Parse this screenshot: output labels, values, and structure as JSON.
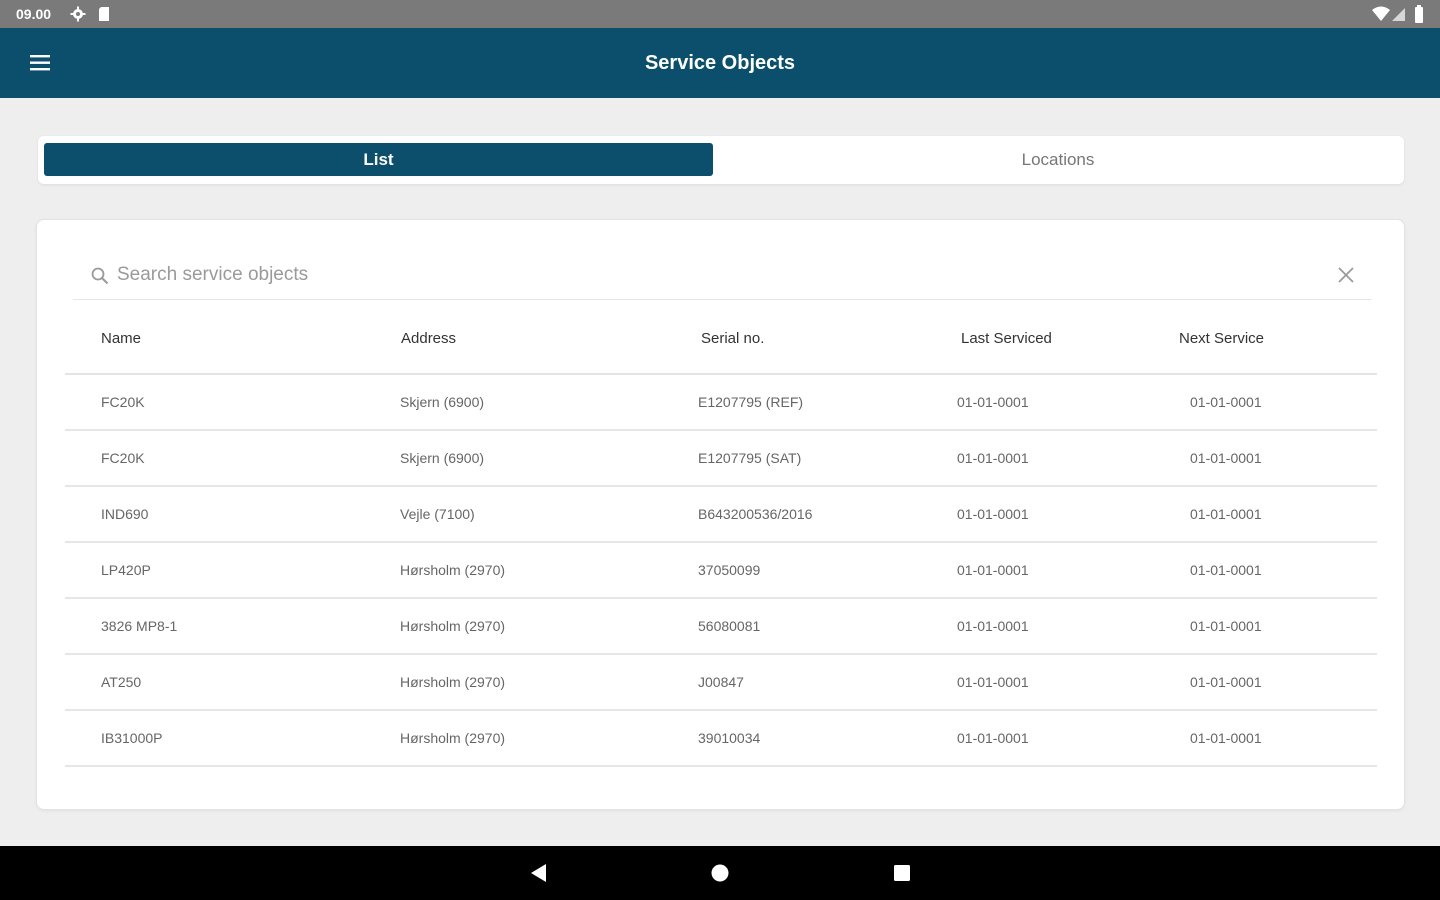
{
  "status_bar": {
    "time": "09.00",
    "icons": [
      "gear-icon",
      "sd-card-icon",
      "wifi-icon",
      "signal-icon",
      "battery-icon"
    ]
  },
  "app_bar": {
    "title": "Service Objects",
    "menu_icon": "hamburger-menu-icon",
    "background": "#0b4f6c"
  },
  "tabs": [
    {
      "label": "List",
      "active": true
    },
    {
      "label": "Locations",
      "active": false
    }
  ],
  "search": {
    "placeholder": "Search service objects",
    "value": "",
    "icon": "search-icon",
    "clear_icon": "close-icon"
  },
  "table": {
    "columns": [
      "Name",
      "Address",
      "Serial no.",
      "Last Serviced",
      "Next Service"
    ],
    "rows": [
      [
        "FC20K",
        "Skjern (6900)",
        "E1207795 (REF)",
        "01-01-0001",
        "01-01-0001"
      ],
      [
        "FC20K",
        "Skjern (6900)",
        "E1207795 (SAT)",
        "01-01-0001",
        "01-01-0001"
      ],
      [
        "IND690",
        "Vejle (7100)",
        "B643200536/2016",
        "01-01-0001",
        "01-01-0001"
      ],
      [
        "LP420P",
        "Hørsholm (2970)",
        "37050099",
        "01-01-0001",
        "01-01-0001"
      ],
      [
        "3826 MP8-1",
        "Hørsholm (2970)",
        "56080081",
        "01-01-0001",
        "01-01-0001"
      ],
      [
        "AT250",
        "Hørsholm (2970)",
        "J00847",
        "01-01-0001",
        "01-01-0001"
      ],
      [
        "IB31000P",
        "Hørsholm (2970)",
        "39010034",
        "01-01-0001",
        "01-01-0001"
      ]
    ]
  },
  "nav_bar": {
    "icons": [
      "back-icon",
      "home-icon",
      "recent-apps-icon"
    ]
  },
  "colors": {
    "primary": "#0b4f6c",
    "status_bar": "#7a7a7a",
    "background": "#eeeeee"
  }
}
